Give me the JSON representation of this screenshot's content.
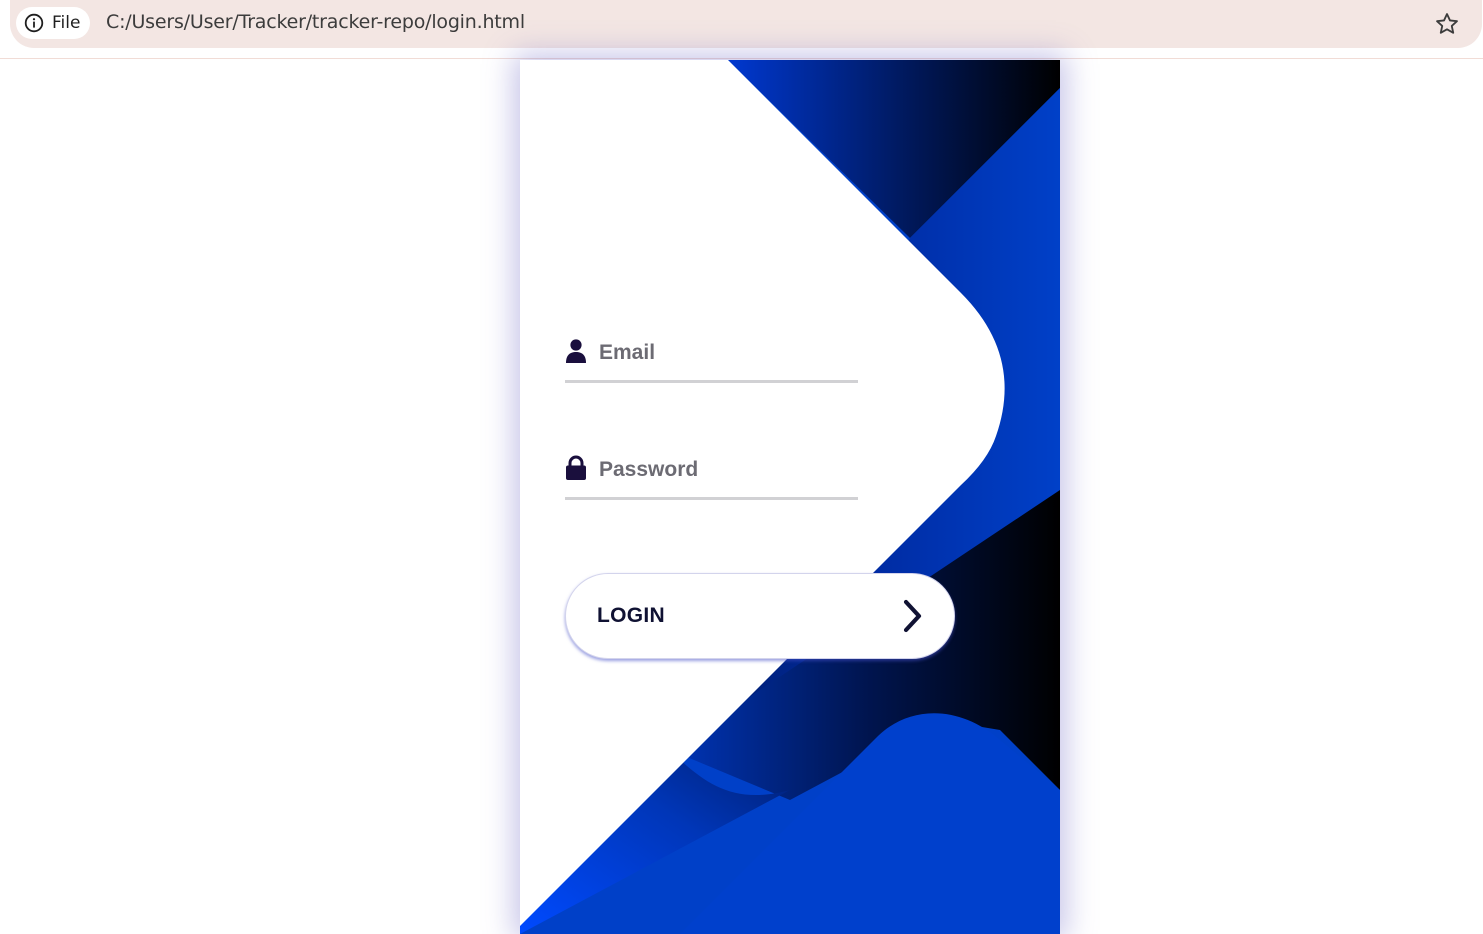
{
  "browser": {
    "site_chip_label": "File",
    "url": "C:/Users/User/Tracker/tracker-repo/login.html",
    "info_icon": "info-icon",
    "bookmark_icon": "star-icon"
  },
  "login_form": {
    "email": {
      "icon": "user-icon",
      "placeholder": "Email",
      "value": ""
    },
    "password": {
      "icon": "lock-icon",
      "placeholder": "Password",
      "value": ""
    },
    "submit": {
      "label": "LOGIN",
      "icon": "chevron-right-icon"
    }
  },
  "colors": {
    "accent_blue": "#0041c9",
    "dark_navy": "#001a5c",
    "icon_color": "#1a0f3d",
    "omnibox_bg": "#f3e6e3"
  }
}
